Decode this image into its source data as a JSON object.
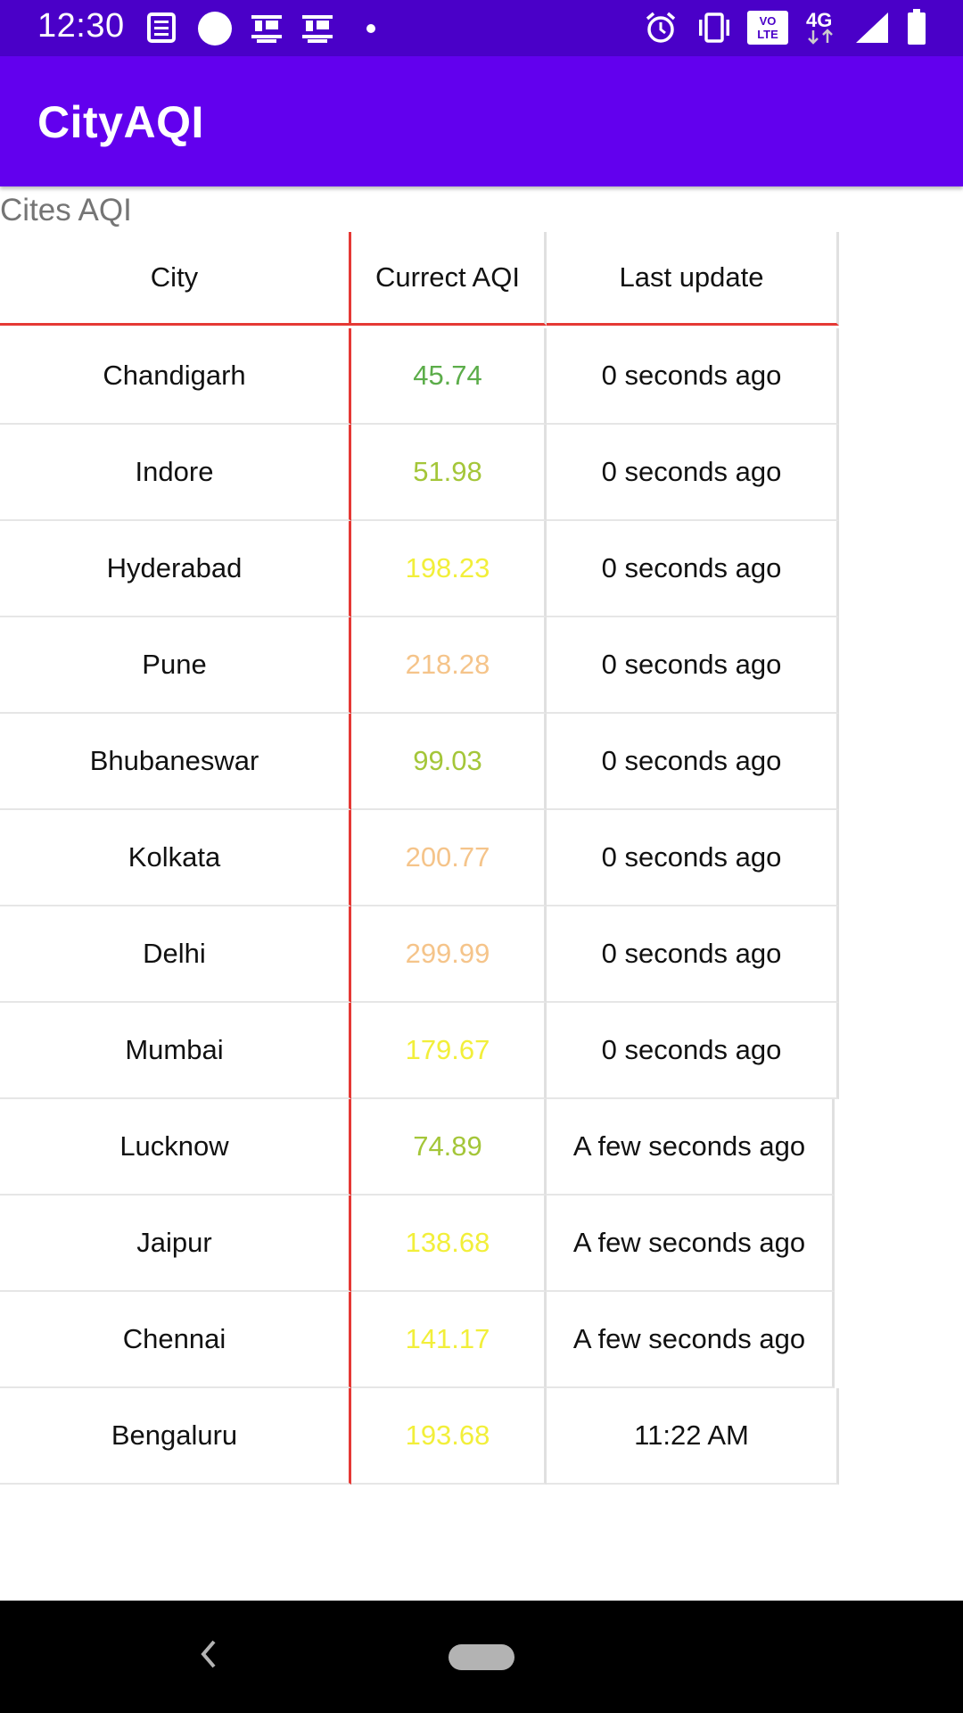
{
  "status_bar": {
    "time": "12:30",
    "network_label": "4G",
    "volte_label": "VO LTE",
    "icons": [
      "news-icon",
      "circle-app-icon",
      "dainik-bhaskar-icon",
      "dainik-bhaskar-icon",
      "dot-icon",
      "alarm-icon",
      "vibrate-icon",
      "volte-icon",
      "network-4g-icon",
      "signal-icon",
      "battery-icon"
    ]
  },
  "app_bar": {
    "title": "CityAQI"
  },
  "section_label": "Cites AQI",
  "colors": {
    "app_bar": "#6200ee",
    "status_bar": "#4a00c8",
    "header_divider": "#e53935",
    "aqi_good": "#5cad4a",
    "aqi_satisfactory": "#a4c639",
    "aqi_moderate": "#f2ef3a",
    "aqi_poor": "#f5c48a"
  },
  "table": {
    "headers": {
      "city": "City",
      "aqi": "Currect AQI",
      "updated": "Last update"
    },
    "rows": [
      {
        "city": "Chandigarh",
        "aqi": "45.74",
        "updated": "0 seconds ago",
        "color": "#5cad4a"
      },
      {
        "city": "Indore",
        "aqi": "51.98",
        "updated": "0 seconds ago",
        "color": "#a4c639"
      },
      {
        "city": "Hyderabad",
        "aqi": "198.23",
        "updated": "0 seconds ago",
        "color": "#f2ef3a"
      },
      {
        "city": "Pune",
        "aqi": "218.28",
        "updated": "0 seconds ago",
        "color": "#f5c48a"
      },
      {
        "city": "Bhubaneswar",
        "aqi": "99.03",
        "updated": "0 seconds ago",
        "color": "#a4c639"
      },
      {
        "city": "Kolkata",
        "aqi": "200.77",
        "updated": "0 seconds ago",
        "color": "#f5c48a"
      },
      {
        "city": "Delhi",
        "aqi": "299.99",
        "updated": "0 seconds ago",
        "color": "#f5c48a"
      },
      {
        "city": "Mumbai",
        "aqi": "179.67",
        "updated": "0 seconds ago",
        "color": "#f2ef3a"
      },
      {
        "city": "Lucknow",
        "aqi": "74.89",
        "updated": "A few seconds ago",
        "color": "#a4c639"
      },
      {
        "city": "Jaipur",
        "aqi": "138.68",
        "updated": "A few seconds ago",
        "color": "#f2ef3a"
      },
      {
        "city": "Chennai",
        "aqi": "141.17",
        "updated": "A few seconds ago",
        "color": "#f2ef3a"
      },
      {
        "city": "Bengaluru",
        "aqi": "193.68",
        "updated": "11:22 AM",
        "color": "#f2ef3a"
      }
    ]
  },
  "nav_bar": {
    "icons": [
      "back-icon",
      "home-pill-icon"
    ]
  }
}
